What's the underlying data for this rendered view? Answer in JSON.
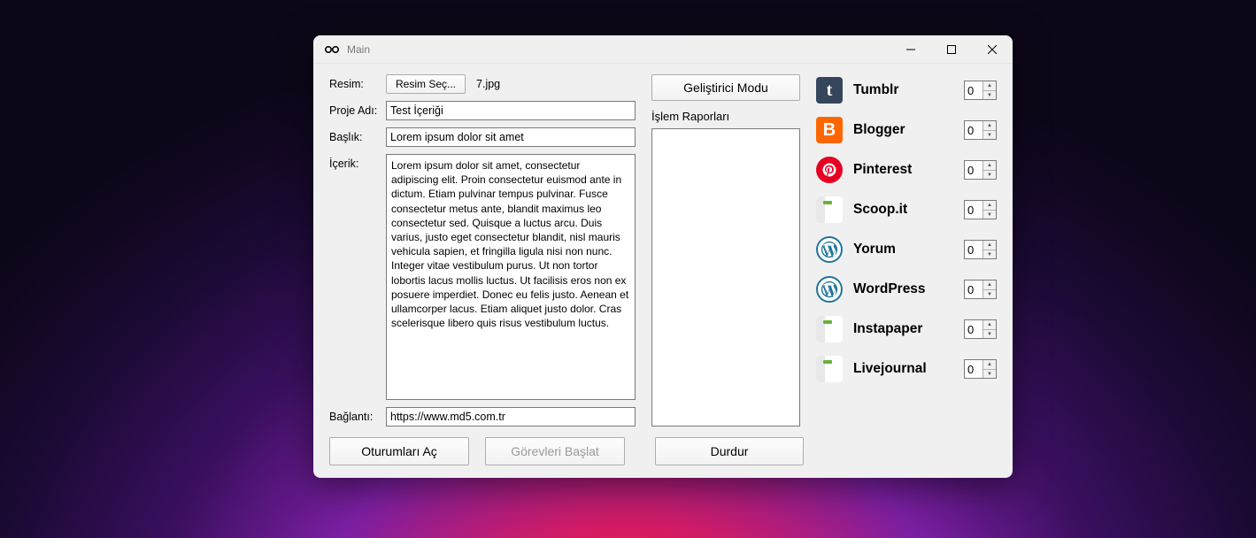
{
  "window": {
    "title": "Main"
  },
  "labels": {
    "resim": "Resim:",
    "resimSec": "Resim Seç...",
    "file": "7.jpg",
    "proje": "Proje Adı:",
    "baslik": "Başlık:",
    "icerik": "İçerik:",
    "baglanti": "Bağlantı:",
    "rapor": "İşlem Raporları"
  },
  "fields": {
    "proje": "Test İçeriği",
    "baslik": "Lorem ipsum dolor sit amet",
    "icerik": "Lorem ipsum dolor sit amet, consectetur adipiscing elit. Proin consectetur euismod ante in dictum. Etiam pulvinar tempus pulvinar. Fusce consectetur metus ante, blandit maximus leo consectetur sed. Quisque a luctus arcu. Duis varius, justo eget consectetur blandit, nisl mauris vehicula sapien, et fringilla ligula nisi non nunc. Integer vitae vestibulum purus. Ut non tortor lobortis lacus mollis luctus. Ut facilisis eros non ex posuere imperdiet. Donec eu felis justo. Aenean et ullamcorper lacus. Etiam aliquet justo dolor. Cras scelerisque libero quis risus vestibulum luctus.",
    "baglanti": "https://www.md5.com.tr"
  },
  "buttons": {
    "dev": "Geliştirici Modu",
    "oturum": "Oturumları Aç",
    "gorev": "Görevleri Başlat",
    "durdur": "Durdur"
  },
  "services": [
    {
      "name": "Tumblr",
      "value": "0",
      "bg": "#35465c",
      "letter": "t",
      "type": "tumblr"
    },
    {
      "name": "Blogger",
      "value": "0",
      "bg": "#ff6600",
      "letter": "B",
      "type": "blogger"
    },
    {
      "name": "Pinterest",
      "value": "0",
      "bg": "#e60023",
      "letter": "P",
      "type": "pinterest"
    },
    {
      "name": "Scoop.it",
      "value": "0",
      "bg": "",
      "letter": "",
      "type": "generic"
    },
    {
      "name": "Yorum",
      "value": "0",
      "bg": "#21759b",
      "letter": "W",
      "type": "wp"
    },
    {
      "name": "WordPress",
      "value": "0",
      "bg": "#21759b",
      "letter": "W",
      "type": "wp"
    },
    {
      "name": "Instapaper",
      "value": "0",
      "bg": "",
      "letter": "",
      "type": "generic"
    },
    {
      "name": "Livejournal",
      "value": "0",
      "bg": "",
      "letter": "",
      "type": "generic"
    }
  ]
}
